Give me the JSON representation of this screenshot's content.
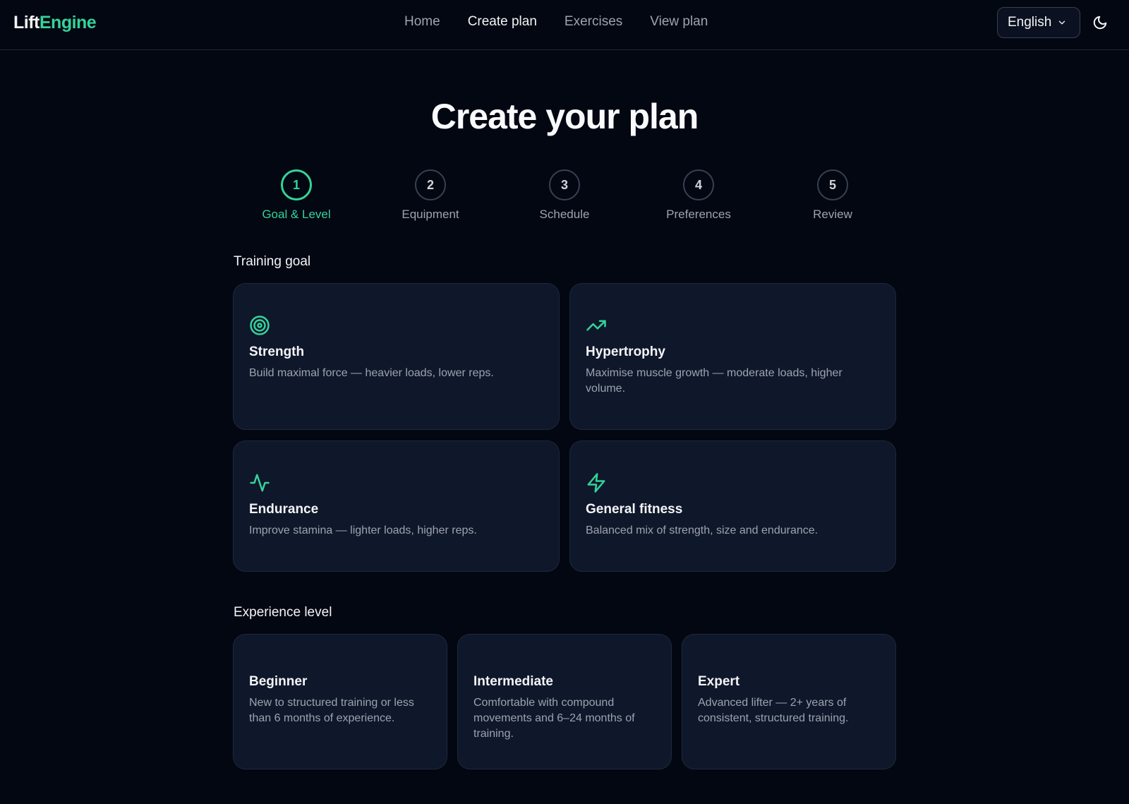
{
  "brand": {
    "part1": "Lift",
    "part2": "Engine"
  },
  "nav": {
    "items": [
      {
        "label": "Home"
      },
      {
        "label": "Create plan"
      },
      {
        "label": "Exercises"
      },
      {
        "label": "View plan"
      }
    ],
    "active": "Create plan"
  },
  "language": {
    "selected": "English"
  },
  "page": {
    "title": "Create your plan"
  },
  "steps": [
    {
      "number": "1",
      "label": "Goal & Level"
    },
    {
      "number": "2",
      "label": "Equipment"
    },
    {
      "number": "3",
      "label": "Schedule"
    },
    {
      "number": "4",
      "label": "Preferences"
    },
    {
      "number": "5",
      "label": "Review"
    }
  ],
  "training_goal": {
    "label": "Training goal",
    "options": [
      {
        "title": "Strength",
        "description": "Build maximal force — heavier loads, lower reps.",
        "icon": "target-icon"
      },
      {
        "title": "Hypertrophy",
        "description": "Maximise muscle growth — moderate loads, higher volume.",
        "icon": "trending-up-icon"
      },
      {
        "title": "Endurance",
        "description": "Improve stamina — lighter loads, higher reps.",
        "icon": "activity-icon"
      },
      {
        "title": "General fitness",
        "description": "Balanced mix of strength, size and endurance.",
        "icon": "zap-icon"
      }
    ]
  },
  "experience_level": {
    "label": "Experience level",
    "options": [
      {
        "title": "Beginner",
        "description": "New to structured training or less than 6 months of experience."
      },
      {
        "title": "Intermediate",
        "description": "Comfortable with compound movements and 6–24 months of training."
      },
      {
        "title": "Expert",
        "description": "Advanced lifter — 2+ years of consistent, structured training."
      }
    ]
  },
  "colors": {
    "accent": "#34d399",
    "background": "#030712",
    "card": "#0f172a"
  }
}
